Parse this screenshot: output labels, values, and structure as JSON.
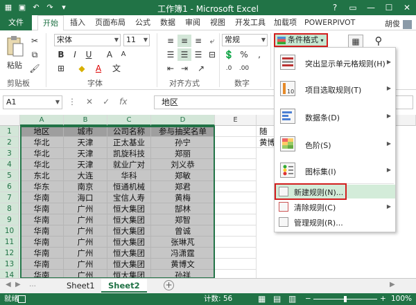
{
  "window": {
    "title": "工作簿1 - Microsoft Excel"
  },
  "tabs": [
    {
      "id": "file",
      "label": "文件"
    },
    {
      "id": "home",
      "label": "开始"
    },
    {
      "id": "insert",
      "label": "插入"
    },
    {
      "id": "layout",
      "label": "页面布局"
    },
    {
      "id": "formula",
      "label": "公式"
    },
    {
      "id": "data",
      "label": "数据"
    },
    {
      "id": "review",
      "label": "审阅"
    },
    {
      "id": "view",
      "label": "视图"
    },
    {
      "id": "dev",
      "label": "开发工具"
    },
    {
      "id": "addin",
      "label": "加载项"
    },
    {
      "id": "pp",
      "label": "POWERPIVOT"
    }
  ],
  "user": {
    "name": "胡俊"
  },
  "ribbon": {
    "paste_label": "粘贴",
    "clipboard_label": "剪贴板",
    "font_label": "字体",
    "align_label": "对齐方式",
    "number_label": "数字",
    "font_name": "宋体",
    "font_size": "11",
    "number_format": "常规",
    "cf_label": "条件格式"
  },
  "formula_bar": {
    "name_box": "A1",
    "value": "地区"
  },
  "columns": [
    "A",
    "B",
    "C",
    "D",
    "E"
  ],
  "rows": [
    [
      "地区",
      "城市",
      "公司名称",
      "参与抽奖名单"
    ],
    [
      "华北",
      "天津",
      "正太基业",
      "孙宁"
    ],
    [
      "华北",
      "天津",
      "凯旋科技",
      "郑丽"
    ],
    [
      "华北",
      "天津",
      "就业广对",
      "刘义恭"
    ],
    [
      "东北",
      "大连",
      "华科",
      "郑敏"
    ],
    [
      "华东",
      "南京",
      "恒通机械",
      "郑君"
    ],
    [
      "华南",
      "海口",
      "宝信人寿",
      "黄梅"
    ],
    [
      "华南",
      "广州",
      "恒大集团",
      "郜林"
    ],
    [
      "华南",
      "广州",
      "恒大集团",
      "郑智"
    ],
    [
      "华南",
      "广州",
      "恒大集团",
      "曾诚"
    ],
    [
      "华南",
      "广州",
      "恒大集团",
      "张琳芃"
    ],
    [
      "华南",
      "广州",
      "恒大集团",
      "冯潇霆"
    ],
    [
      "华南",
      "广州",
      "恒大集团",
      "黄博文"
    ],
    [
      "华南",
      "广州",
      "恒大集团",
      "孙祥"
    ]
  ],
  "side_cells": {
    "g1": "随",
    "g2": "黄博"
  },
  "sheets": [
    "Sheet1",
    "Sheet2"
  ],
  "status": {
    "ready": "就绪",
    "count": "计数: 56",
    "zoom": "100%"
  },
  "menu": {
    "items": [
      {
        "label": "突出显示单元格规则(H)"
      },
      {
        "label": "项目选取规则(T)"
      },
      {
        "label": "数据条(D)"
      },
      {
        "label": "色阶(S)"
      },
      {
        "label": "图标集(I)"
      },
      {
        "label": "新建规则(N)..."
      },
      {
        "label": "清除规则(C)"
      },
      {
        "label": "管理规则(R)..."
      }
    ]
  },
  "colors": {
    "accent": "#217346",
    "highlight_red": "#d21e1e",
    "hover": "#d3ecd9"
  }
}
